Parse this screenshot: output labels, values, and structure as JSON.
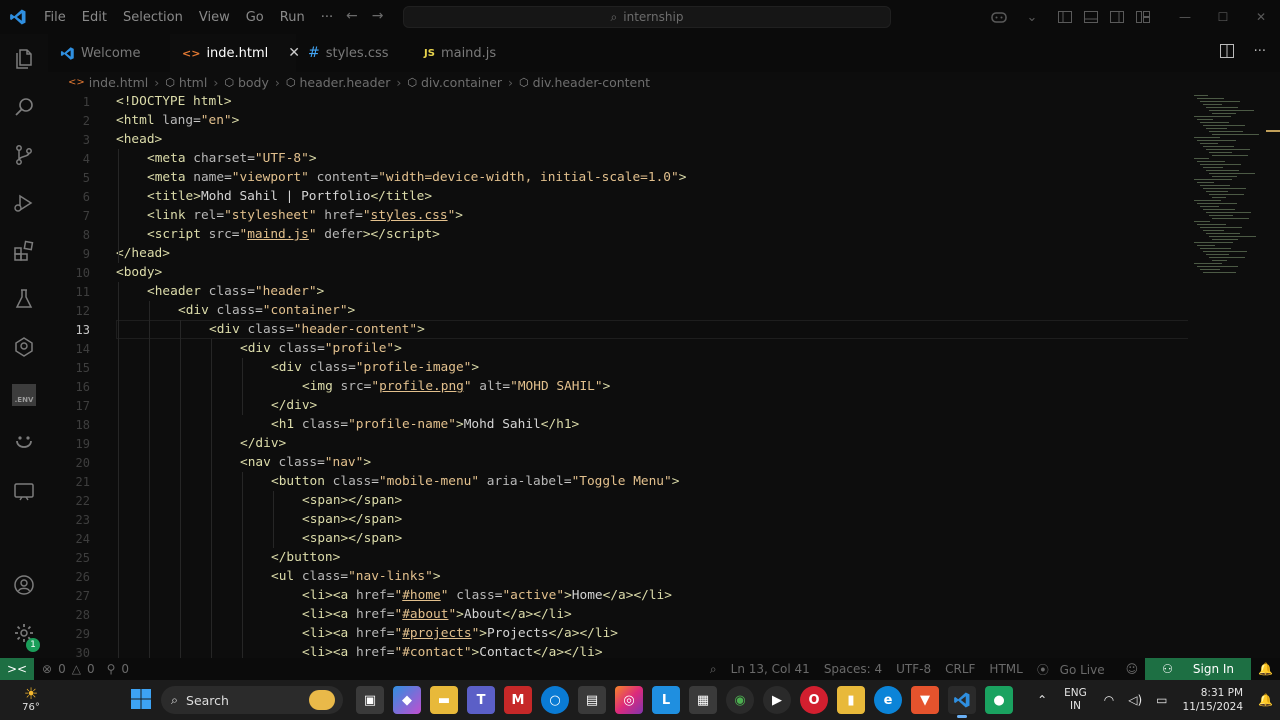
{
  "titlebar": {
    "menu": [
      "File",
      "Edit",
      "Selection",
      "View",
      "Go",
      "Run",
      "···"
    ],
    "search_text": "internship"
  },
  "tabs": [
    {
      "label": "Welcome",
      "icon": "vscode-logo-icon"
    },
    {
      "label": "inde.html",
      "icon": "html-icon",
      "active": true
    },
    {
      "label": "styles.css",
      "icon": "css-icon"
    },
    {
      "label": "maind.js",
      "icon": "js-icon",
      "badge": "JS"
    }
  ],
  "breadcrumbs": [
    "inde.html",
    "html",
    "body",
    "header.header",
    "div.container",
    "div.header-content"
  ],
  "editor": {
    "lines": [
      {
        "n": "1",
        "indent": 0,
        "html": "<span class='tag'>&lt;!DOCTYPE html&gt;</span>"
      },
      {
        "n": "2",
        "indent": 0,
        "html": "<span class='tag'>&lt;html</span> <span class='t-attr'>lang</span>=<span class='t-str'>\"en\"</span><span class='tag'>&gt;</span>"
      },
      {
        "n": "3",
        "indent": 0,
        "html": "<span class='tag'>&lt;head&gt;</span>"
      },
      {
        "n": "4",
        "indent": 1,
        "html": "<span class='tag'>&lt;meta</span> <span class='t-attr'>charset</span>=<span class='t-str'>\"UTF-8\"</span><span class='tag'>&gt;</span>"
      },
      {
        "n": "5",
        "indent": 1,
        "html": "<span class='tag'>&lt;meta</span> <span class='t-attr'>name</span>=<span class='t-str'>\"viewport\"</span> <span class='t-attr'>content</span>=<span class='t-str'>\"width=device-width, initial-scale=1.0\"</span><span class='tag'>&gt;</span>"
      },
      {
        "n": "6",
        "indent": 1,
        "html": "<span class='tag'>&lt;title&gt;</span><span class='t-txt'>Mohd Sahil | Portfolio</span><span class='tag'>&lt;/title&gt;</span>"
      },
      {
        "n": "7",
        "indent": 1,
        "html": "<span class='tag'>&lt;link</span> <span class='t-attr'>rel</span>=<span class='t-str'>\"stylesheet\"</span> <span class='t-attr'>href</span>=<span class='t-str'>\"<span class='t-link'>styles.css</span>\"</span><span class='tag'>&gt;</span>"
      },
      {
        "n": "8",
        "indent": 1,
        "html": "<span class='tag'>&lt;script</span> <span class='t-attr'>src</span>=<span class='t-str'>\"<span class='t-link'>maind.js</span>\"</span> <span class='t-attr'>defer</span><span class='tag'>&gt;&lt;/script&gt;</span>"
      },
      {
        "n": "9",
        "indent": 0,
        "html": "<span class='tag'>&lt;/head&gt;</span>"
      },
      {
        "n": "10",
        "indent": 0,
        "html": "<span class='tag'>&lt;body&gt;</span>"
      },
      {
        "n": "11",
        "indent": 1,
        "html": "<span class='tag'>&lt;header</span> <span class='t-attr'>class</span>=<span class='t-str'>\"header\"</span><span class='tag'>&gt;</span>"
      },
      {
        "n": "12",
        "indent": 2,
        "html": "<span class='tag'>&lt;div</span> <span class='t-attr'>class</span>=<span class='t-str'>\"container\"</span><span class='tag'>&gt;</span>"
      },
      {
        "n": "13",
        "indent": 3,
        "html": "<span class='tag'>&lt;div</span> <span class='t-attr'>class</span>=<span class='t-str'>\"header-content\"</span><span class='tag'>&gt;</span>"
      },
      {
        "n": "14",
        "indent": 4,
        "html": "<span class='tag'>&lt;div</span> <span class='t-attr'>class</span>=<span class='t-str'>\"profile\"</span><span class='tag'>&gt;</span>"
      },
      {
        "n": "15",
        "indent": 5,
        "html": "<span class='tag'>&lt;div</span> <span class='t-attr'>class</span>=<span class='t-str'>\"profile-image\"</span><span class='tag'>&gt;</span>"
      },
      {
        "n": "16",
        "indent": 6,
        "html": "<span class='tag'>&lt;img</span> <span class='t-attr'>src</span>=<span class='t-str'>\"<span class='t-link'>profile.png</span>\"</span> <span class='t-attr'>alt</span>=<span class='t-str'>\"MOHD SAHIL\"</span><span class='tag'>&gt;</span>"
      },
      {
        "n": "17",
        "indent": 5,
        "html": "<span class='tag'>&lt;/div&gt;</span>"
      },
      {
        "n": "18",
        "indent": 5,
        "html": "<span class='tag'>&lt;h1</span> <span class='t-attr'>class</span>=<span class='t-str'>\"profile-name\"</span><span class='tag'>&gt;</span><span class='t-txt'>Mohd Sahil</span><span class='tag'>&lt;/h1&gt;</span>"
      },
      {
        "n": "19",
        "indent": 4,
        "html": "<span class='tag'>&lt;/div&gt;</span>"
      },
      {
        "n": "20",
        "indent": 4,
        "html": "<span class='tag'>&lt;nav</span> <span class='t-attr'>class</span>=<span class='t-str'>\"nav\"</span><span class='tag'>&gt;</span>"
      },
      {
        "n": "21",
        "indent": 5,
        "html": "<span class='tag'>&lt;button</span> <span class='t-attr'>class</span>=<span class='t-str'>\"mobile-menu\"</span> <span class='t-attr'>aria-label</span>=<span class='t-str'>\"Toggle Menu\"</span><span class='tag'>&gt;</span>"
      },
      {
        "n": "22",
        "indent": 6,
        "html": "<span class='tag'>&lt;span&gt;&lt;/span&gt;</span>"
      },
      {
        "n": "23",
        "indent": 6,
        "html": "<span class='tag'>&lt;span&gt;&lt;/span&gt;</span>"
      },
      {
        "n": "24",
        "indent": 6,
        "html": "<span class='tag'>&lt;span&gt;&lt;/span&gt;</span>"
      },
      {
        "n": "25",
        "indent": 5,
        "html": "<span class='tag'>&lt;/button&gt;</span>"
      },
      {
        "n": "26",
        "indent": 5,
        "html": "<span class='tag'>&lt;ul</span> <span class='t-attr'>class</span>=<span class='t-str'>\"nav-links\"</span><span class='tag'>&gt;</span>"
      },
      {
        "n": "27",
        "indent": 6,
        "html": "<span class='tag'>&lt;li&gt;&lt;a</span> <span class='t-attr'>href</span>=<span class='t-str'>\"<span class='t-link'>#home</span>\"</span> <span class='t-attr'>class</span>=<span class='t-str'>\"active\"</span><span class='tag'>&gt;</span><span class='t-txt'>Home</span><span class='tag'>&lt;/a&gt;&lt;/li&gt;</span>"
      },
      {
        "n": "28",
        "indent": 6,
        "html": "<span class='tag'>&lt;li&gt;&lt;a</span> <span class='t-attr'>href</span>=<span class='t-str'>\"<span class='t-link'>#about</span>\"</span><span class='tag'>&gt;</span><span class='t-txt'>About</span><span class='tag'>&lt;/a&gt;&lt;/li&gt;</span>"
      },
      {
        "n": "29",
        "indent": 6,
        "html": "<span class='tag'>&lt;li&gt;&lt;a</span> <span class='t-attr'>href</span>=<span class='t-str'>\"<span class='t-link'>#projects</span>\"</span><span class='tag'>&gt;</span><span class='t-txt'>Projects</span><span class='tag'>&lt;/a&gt;&lt;/li&gt;</span>"
      },
      {
        "n": "30",
        "indent": 6,
        "html": "<span class='tag'>&lt;li&gt;&lt;a</span> <span class='t-attr'>href</span>=<span class='t-str'>\"#contact\"</span><span class='tag'>&gt;</span><span class='t-txt'>Contact</span><span class='tag'>&lt;/a&gt;&lt;/li&gt;</span>"
      }
    ],
    "current_line": "13"
  },
  "status": {
    "errors": "0",
    "warnings": "0",
    "ports": "0",
    "position": "Ln 13, Col 41",
    "spaces": "Spaces: 4",
    "encoding": "UTF-8",
    "eol": "CRLF",
    "language": "HTML",
    "golive": "Go Live",
    "signin": "Sign In"
  },
  "taskbar": {
    "weather_temp": "76°",
    "search_label": "Search",
    "lang_top": "ENG",
    "lang_bottom": "IN",
    "time": "8:31 PM",
    "date": "11/15/2024"
  },
  "colors": {
    "accent_green": "#1d6f43",
    "tag_yellow": "#dcdcaa",
    "string_orange": "#e2c08d"
  }
}
